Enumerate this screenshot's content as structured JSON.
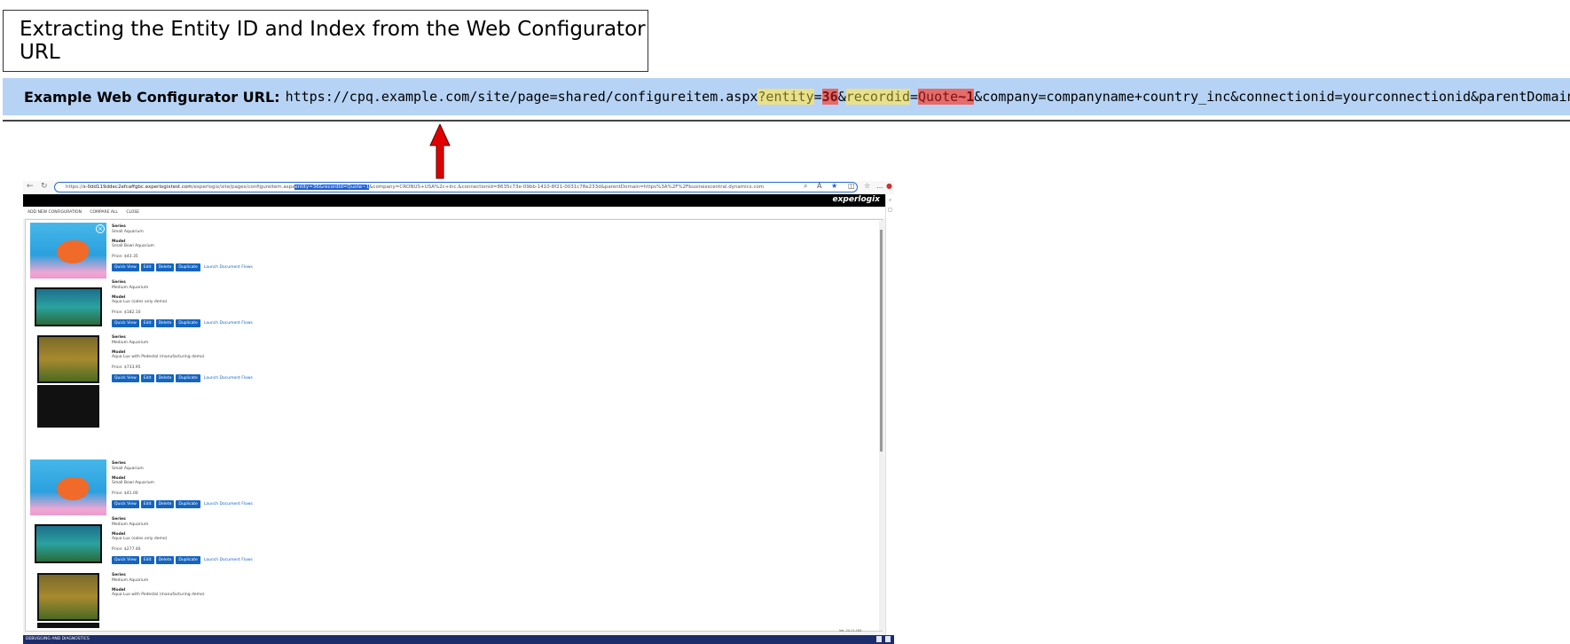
{
  "header": {
    "title": "Extracting the Entity ID and Index from the Web Configurator URL"
  },
  "url_banner": {
    "label": "Example Web Configurator URL:",
    "base": "https://cpq.example.com/site/page=shared/configureitem.aspx",
    "q": "?",
    "entity_key": "entity",
    "eq1": "=",
    "entity_value": "36",
    "amp1": "&",
    "recordid_key": "recordid",
    "eq2": "=",
    "recordid_value_text": "Quote",
    "recordid_value_idx": "~1",
    "rest": "&company=companyname+country_inc&connectionid=yourconnectionid&parentDomain=https"
  },
  "colors": {
    "banner_bg": "#b6d3f5",
    "highlight_key": "#e9e08b",
    "highlight_value": "#e66b6b",
    "arrow": "#e10000"
  },
  "screenshot": {
    "address": {
      "prefix": "https://",
      "host": "s-0dd119ddec2efcaffgbc.experlogixtest.com",
      "path": "/experlogix/site/pages/configureitem.aspx",
      "selected": "entity=36&recordid=Quote~1",
      "after": "&company=CRONUS+USA%2c+Inc.&connectionid=8635c73e-09bb-1410-8f21-0031c78e233d&parentDomain=https%3A%2F%2Fbusinesscentral.dynamics.com"
    },
    "logo": "experlogix",
    "toolbar": {
      "add": "ADD NEW CONFIGURATION",
      "compare": "COMPARE ALL",
      "close": "CLOSE"
    },
    "items": [
      {
        "series_label": "Series",
        "series": "Small Aquarium",
        "model_label": "Model",
        "model": "Small Bowl Aquarium",
        "price": "Price: $43.35"
      },
      {
        "series_label": "Series",
        "series": "Medium Aquarium",
        "model_label": "Model",
        "model": "Aqua Lux (sales only demo)",
        "price": "Price: $182.10"
      },
      {
        "series_label": "Series",
        "series": "Medium Aquarium",
        "model_label": "Model",
        "model": "Aqua Lux with Pedestal (manufacturing demo)",
        "price": "Price: $733.95"
      },
      {
        "series_label": "Series",
        "series": "Small Aquarium",
        "model_label": "Model",
        "model": "Small Bowl Aquarium",
        "price": "Price: $41.00"
      },
      {
        "series_label": "Series",
        "series": "Medium Aquarium",
        "model_label": "Model",
        "model": "Aqua Lux (sales only demo)",
        "price": "Price: $277.46"
      },
      {
        "series_label": "Series",
        "series": "Medium Aquarium",
        "model_label": "Model",
        "model": "Aqua Lux with Pedestal (manufacturing demo)",
        "price": ""
      }
    ],
    "buttons": {
      "quick_view": "Quick View",
      "edit": "Edit",
      "delete": "Delete",
      "duplicate": "Duplicate",
      "launch": "Launch Document Flows"
    },
    "status": "DEBUGGING AND DIAGNOSTICS",
    "version": "Ver. 24.11.165"
  }
}
